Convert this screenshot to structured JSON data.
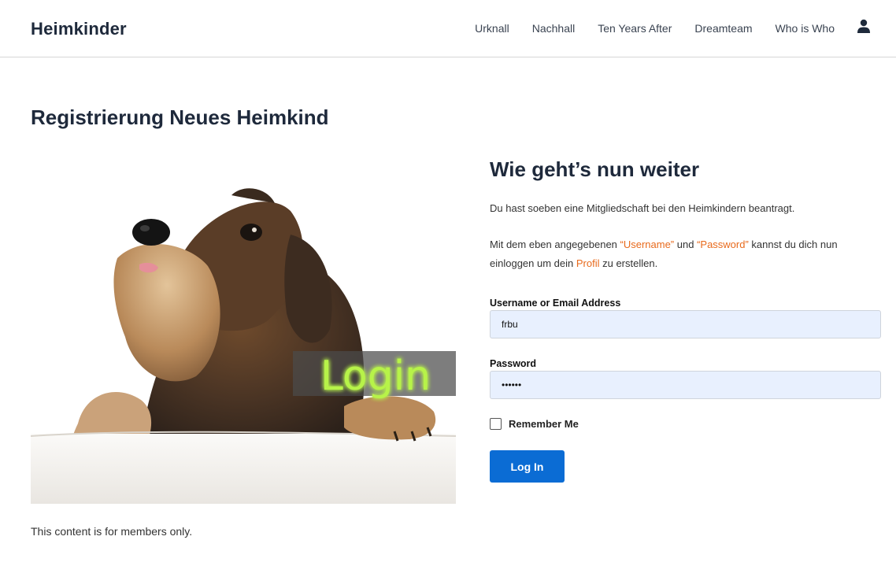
{
  "header": {
    "brand": "Heimkinder",
    "nav": [
      "Urknall",
      "Nachhall",
      "Ten Years After",
      "Dreamteam",
      "Who is Who"
    ],
    "user_icon": "user-icon"
  },
  "page_title": "Registrierung Neues Heimkind",
  "hero": {
    "overlay_text": "Login"
  },
  "members_note": "This content is for members only.",
  "side": {
    "heading": "Wie geht’s nun weiter",
    "p1": "Du hast soeben eine Mitgliedschaft bei den Heimkindern beantragt.",
    "p2_a": "Mit dem eben angegebenen ",
    "p2_username": "“Username”",
    "p2_b": " und ",
    "p2_password": "“Password”",
    "p2_c": " kannst du dich nun einloggen um dein ",
    "p2_profil": "Profil",
    "p2_d": " zu erstellen."
  },
  "form": {
    "username_label": "Username or Email Address",
    "username_value": "frbu",
    "password_label": "Password",
    "password_value": "••••••",
    "remember_label": "Remember Me",
    "submit_label": "Log In"
  },
  "colors": {
    "accent": "#0b6cd4",
    "link": "#e86a1c",
    "input_bg": "#e8f0fe"
  }
}
